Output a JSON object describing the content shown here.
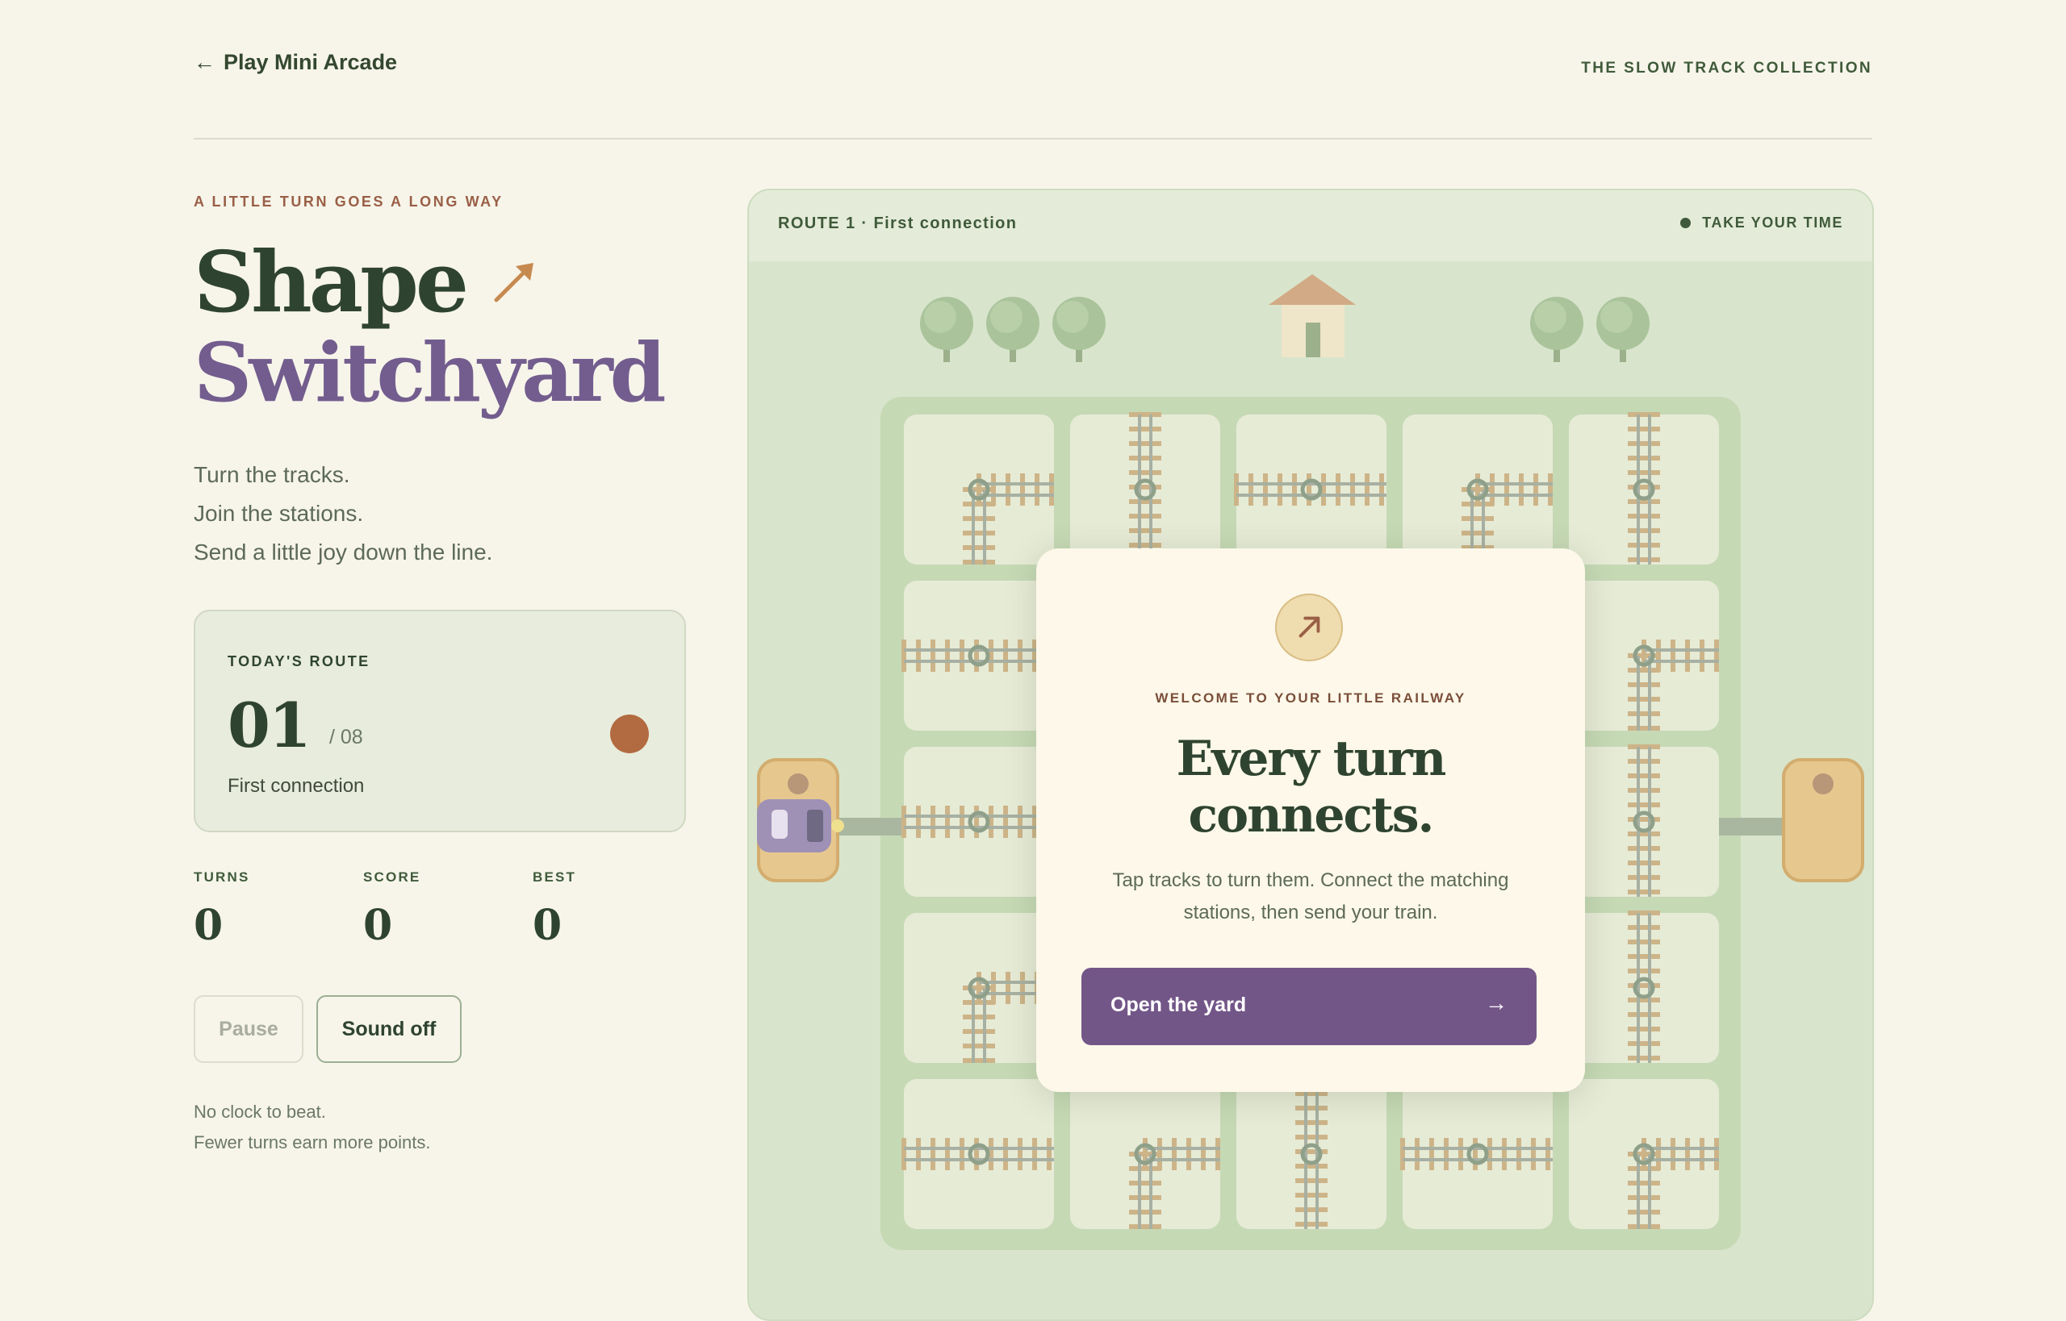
{
  "nav": {
    "back_label": "Play Mini Arcade",
    "collection": "THE SLOW TRACK COLLECTION"
  },
  "hero": {
    "eyebrow": "A LITTLE TURN GOES A LONG WAY",
    "title_line1": "Shape",
    "title_line2": "Switchyard",
    "tagline": [
      "Turn the tracks.",
      "Join the stations.",
      "Send a little joy down the line."
    ]
  },
  "route_card": {
    "label": "TODAY'S ROUTE",
    "number": "01",
    "total": "/ 08",
    "name": "First connection"
  },
  "stats": [
    {
      "label": "TURNS",
      "value": "0"
    },
    {
      "label": "SCORE",
      "value": "0"
    },
    {
      "label": "BEST",
      "value": "0"
    }
  ],
  "controls": {
    "pause_label": "Pause",
    "sound_label": "Sound off"
  },
  "notes": [
    "No clock to beat.",
    "Fewer turns earn more points."
  ],
  "board": {
    "route_label": "ROUTE 1 · First connection",
    "status_label": "TAKE YOUR TIME"
  },
  "modal": {
    "eyebrow": "WELCOME TO YOUR LITTLE RAILWAY",
    "title_line1": "Every turn",
    "title_line2": "connects.",
    "body_line1": "Tap tracks to turn them. Connect the matching",
    "body_line2": "stations, then send your train.",
    "cta_label": "Open the yard",
    "cta_icon": "arrow-right-icon"
  },
  "colors": {
    "background": "#f7f5ea",
    "primary_green": "#2f4430",
    "accent_purple": "#735688",
    "accent_orange": "#b26a40"
  },
  "tiles": [
    [
      "corner-right-down",
      "vertical",
      "horizontal",
      "corner-right-down",
      "vertical"
    ],
    [
      "horizontal",
      "hidden",
      "hidden",
      "hidden",
      "corner-right-down"
    ],
    [
      "horizontal",
      "hidden",
      "hidden",
      "hidden",
      "vertical"
    ],
    [
      "corner-right-down",
      "hidden",
      "hidden",
      "hidden",
      "vertical"
    ],
    [
      "horizontal",
      "corner-right-down",
      "vertical",
      "horizontal",
      "corner-right-down"
    ]
  ]
}
